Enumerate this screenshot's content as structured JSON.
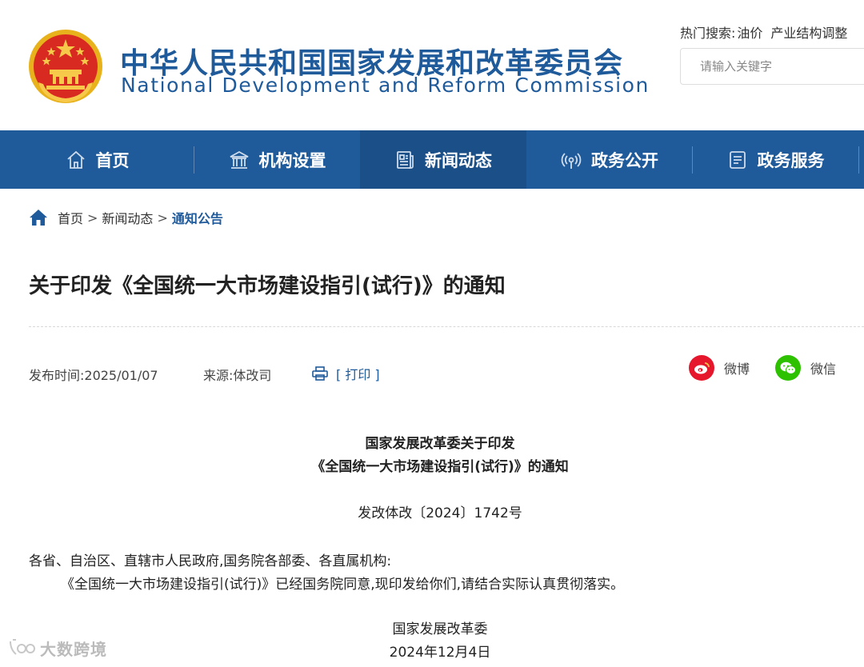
{
  "header": {
    "title_cn": "中华人民共和国国家发展和改革委员会",
    "title_en": "National Development and Reform Commission",
    "hot_search_label": "热门搜索:",
    "hot_search_items": [
      "油价",
      "产业结构调整"
    ],
    "search_placeholder": "请输入关键字"
  },
  "nav": {
    "items": [
      {
        "label": "首页",
        "icon": "home-icon"
      },
      {
        "label": "机构设置",
        "icon": "building-icon"
      },
      {
        "label": "新闻动态",
        "icon": "news-icon"
      },
      {
        "label": "政务公开",
        "icon": "broadcast-icon"
      },
      {
        "label": "政务服务",
        "icon": "service-icon"
      }
    ],
    "active_index": 2
  },
  "breadcrumb": {
    "home": "首页",
    "separator": ">",
    "level2": "新闻动态",
    "current": "通知公告"
  },
  "article": {
    "title": "关于印发《全国统一大市场建设指引(试行)》的通知",
    "publish_time": "发布时间:2025/01/07",
    "source": "来源:体改司",
    "print_label": "[ 打印 ]",
    "share": [
      {
        "label": "微博",
        "icon": "weibo-icon",
        "color": "#e6162d"
      },
      {
        "label": "微信",
        "icon": "wechat-icon",
        "color": "#2dc100"
      }
    ],
    "doc_title_line1": "国家发展改革委关于印发",
    "doc_title_line2": "《全国统一大市场建设指引(试行)》的通知",
    "doc_number": "发改体改〔2024〕1742号",
    "addressee": "各省、自治区、直辖市人民政府,国务院各部委、各直属机构:",
    "body": "《全国统一大市场建设指引(试行)》已经国务院同意,现印发给你们,请结合实际认真贯彻落实。",
    "signature": "国家发展改革委",
    "date": "2024年12月4日"
  },
  "watermark": "大数跨境",
  "colors": {
    "brand_blue": "#1f5a9a",
    "nav_active": "#1a4f88"
  }
}
